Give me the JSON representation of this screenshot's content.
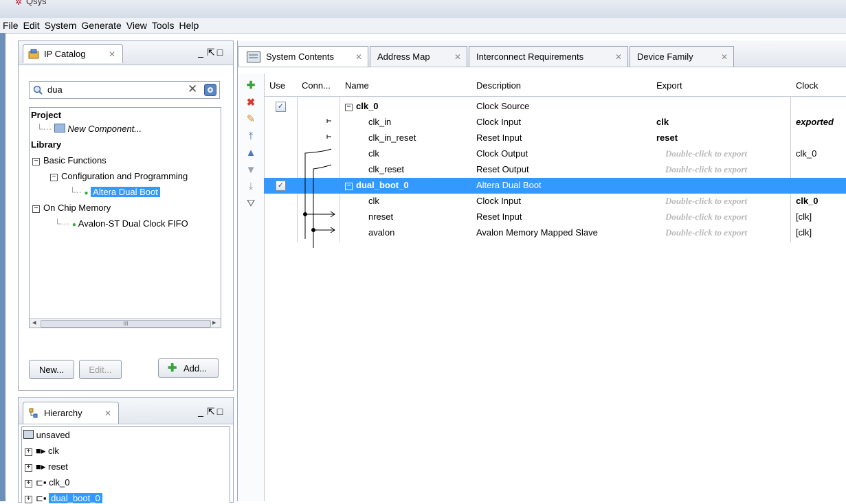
{
  "app": {
    "title": "Qsys"
  },
  "menu": [
    "File",
    "Edit",
    "System",
    "Generate",
    "View",
    "Tools",
    "Help"
  ],
  "ip_catalog": {
    "tab_label": "IP Catalog",
    "search_value": "dua",
    "tree": {
      "project": "Project",
      "new_component": "New Component...",
      "library": "Library",
      "basic_functions": "Basic Functions",
      "config_programming": "Configuration and Programming",
      "altera_dual_boot": "Altera Dual Boot",
      "on_chip_memory": "On Chip Memory",
      "avalon_fifo": "Avalon-ST Dual Clock FIFO"
    },
    "scroll_glyph": "III",
    "buttons": {
      "new": "New...",
      "edit": "Edit...",
      "add": "Add..."
    }
  },
  "hierarchy": {
    "tab_label": "Hierarchy",
    "items": [
      "unsaved",
      "clk",
      "reset",
      "clk_0",
      "dual_boot_0"
    ]
  },
  "main": {
    "tabs": [
      "System Contents",
      "Address Map",
      "Interconnect Requirements",
      "Device Family"
    ],
    "columns": [
      "Use",
      "Conn...",
      "Name",
      "Description",
      "Export",
      "Clock"
    ],
    "rows": [
      {
        "name": "clk_0",
        "description": "Clock Source",
        "export": "",
        "clock": ""
      },
      {
        "name": "clk_in",
        "description": "Clock Input",
        "export": "clk",
        "clock": "exported"
      },
      {
        "name": "clk_in_reset",
        "description": "Reset Input",
        "export": "reset",
        "clock": ""
      },
      {
        "name": "clk",
        "description": "Clock Output",
        "export": "Double-click to export",
        "clock": "clk_0"
      },
      {
        "name": "clk_reset",
        "description": "Reset Output",
        "export": "Double-click to export",
        "clock": ""
      },
      {
        "name": "dual_boot_0",
        "description": "Altera Dual Boot",
        "export": "",
        "clock": ""
      },
      {
        "name": "clk",
        "description": "Clock Input",
        "export": "Double-click to export",
        "clock": "clk_0"
      },
      {
        "name": "nreset",
        "description": "Reset Input",
        "export": "Double-click to export",
        "clock": "[clk]"
      },
      {
        "name": "avalon",
        "description": "Avalon Memory Mapped Slave",
        "export": "Double-click to export",
        "clock": "[clk]"
      }
    ]
  },
  "colors": {
    "selection": "#3399ff",
    "hint_text": "#b8b8b8",
    "menu_bg": "#eef1f6"
  }
}
